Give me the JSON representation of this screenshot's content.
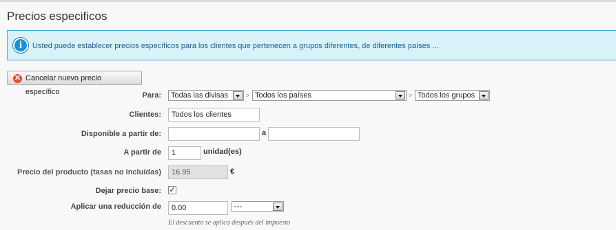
{
  "page": {
    "title": "Precios especificos"
  },
  "info": {
    "text": "Usted puede establecer precios específicos para los clientes que pertenecen a grupos diferentes, de diferentes países ..."
  },
  "cancel_button": {
    "label": "Cancelar nuevo precio específico"
  },
  "form": {
    "para": {
      "label": "Para:",
      "currency": "Todas las divisas",
      "country": "Todos los países",
      "group": "Todos los grupos",
      "separator": ">"
    },
    "clientes": {
      "label": "Clientes:",
      "value": "Todos los clientes"
    },
    "disponible": {
      "label": "Disponible a partir de:",
      "from_value": "",
      "to_label": "a",
      "to_value": ""
    },
    "a_partir": {
      "label": "A partir de",
      "value": "1",
      "unit": "unidad(es)"
    },
    "precio": {
      "label": "Precio del producto (tasas no incluídas)",
      "value": "16.95",
      "currency": "€"
    },
    "dejar_base": {
      "label": "Dejar precio base:",
      "checked": true,
      "check_glyph": "✓"
    },
    "reduccion": {
      "label": "Aplicar una reducción de",
      "value": "0.00",
      "type": "---",
      "hint": "El descuento se aplica después del impuesto"
    }
  },
  "icons": {
    "info": "info-icon",
    "cancel": "x-circle-icon",
    "dropdown": "chevron-down-icon"
  },
  "colors": {
    "info_bg": "#d9f1f9",
    "info_border": "#3fa9d0",
    "info_text": "#1f5e8a",
    "cancel_icon": "#e0502e"
  }
}
